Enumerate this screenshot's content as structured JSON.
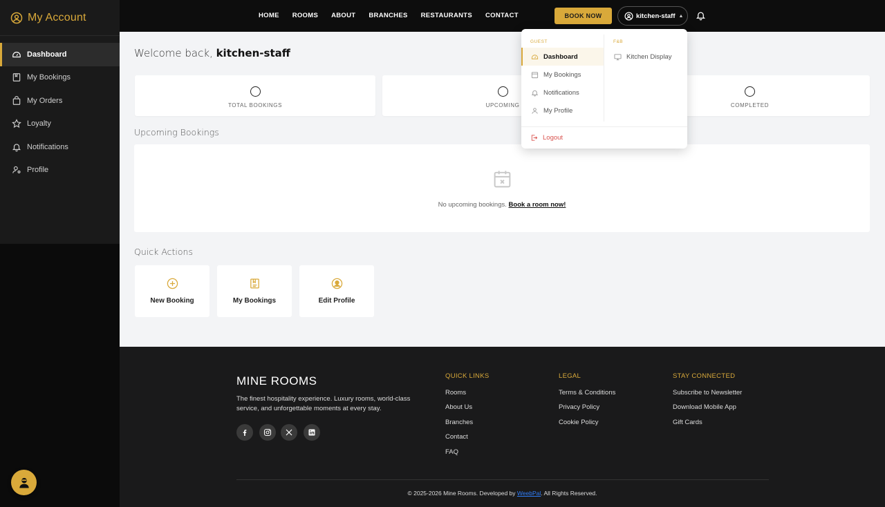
{
  "sidebar": {
    "brand": "My Account",
    "items": [
      {
        "label": "Dashboard",
        "icon": "dashboard-icon"
      },
      {
        "label": "My Bookings",
        "icon": "book-icon"
      },
      {
        "label": "My Orders",
        "icon": "bag-icon"
      },
      {
        "label": "Loyalty",
        "icon": "star-icon"
      },
      {
        "label": "Notifications",
        "icon": "bell-icon"
      },
      {
        "label": "Profile",
        "icon": "user-cog-icon"
      }
    ]
  },
  "header": {
    "nav": [
      "HOME",
      "ROOMS",
      "ABOUT",
      "BRANCHES",
      "RESTAURANTS",
      "CONTACT"
    ],
    "book_now": "BOOK NOW",
    "username": "kitchen-staff"
  },
  "dropdown": {
    "guest_heading": "GUEST",
    "guest_items": [
      "Dashboard",
      "My Bookings",
      "Notifications",
      "My Profile"
    ],
    "fb_heading": "F&B",
    "fb_items": [
      "Kitchen Display"
    ],
    "logout": "Logout"
  },
  "main": {
    "welcome_prefix": "Welcome back,",
    "welcome_name": "kitchen-staff",
    "stats": [
      {
        "label": "TOTAL BOOKINGS"
      },
      {
        "label": "UPCOMING"
      },
      {
        "label": "COMPLETED"
      }
    ],
    "upcoming_title": "Upcoming Bookings",
    "empty_text": "No upcoming bookings.",
    "empty_link": "Book a room now!",
    "quick_actions_title": "Quick Actions",
    "quick_actions": [
      {
        "label": "New Booking",
        "icon": "plus-circle-icon"
      },
      {
        "label": "My Bookings",
        "icon": "book-icon"
      },
      {
        "label": "Edit Profile",
        "icon": "user-circle-icon"
      }
    ]
  },
  "footer": {
    "brand": "MINE ROOMS",
    "description": "The finest hospitality experience. Luxury rooms, world-class service, and unforgettable moments at every stay.",
    "quick_links_title": "QUICK LINKS",
    "quick_links": [
      "Rooms",
      "About Us",
      "Branches",
      "Contact",
      "FAQ"
    ],
    "legal_title": "LEGAL",
    "legal_links": [
      "Terms & Conditions",
      "Privacy Policy",
      "Cookie Policy"
    ],
    "stay_title": "STAY CONNECTED",
    "stay_links": [
      "Subscribe to Newsletter",
      "Download Mobile App",
      "Gift Cards"
    ],
    "copyright_prefix": "© 2025-2026 Mine Rooms. Developed by",
    "copyright_link": "WeebPal",
    "copyright_suffix": ". All Rights Reserved."
  },
  "colors": {
    "accent": "#d9a93a",
    "sidebar_bg": "#1a1a1a",
    "header_bg": "#0d0d0d",
    "footer_bg": "#1a1a1b",
    "logout": "#d9534f"
  }
}
